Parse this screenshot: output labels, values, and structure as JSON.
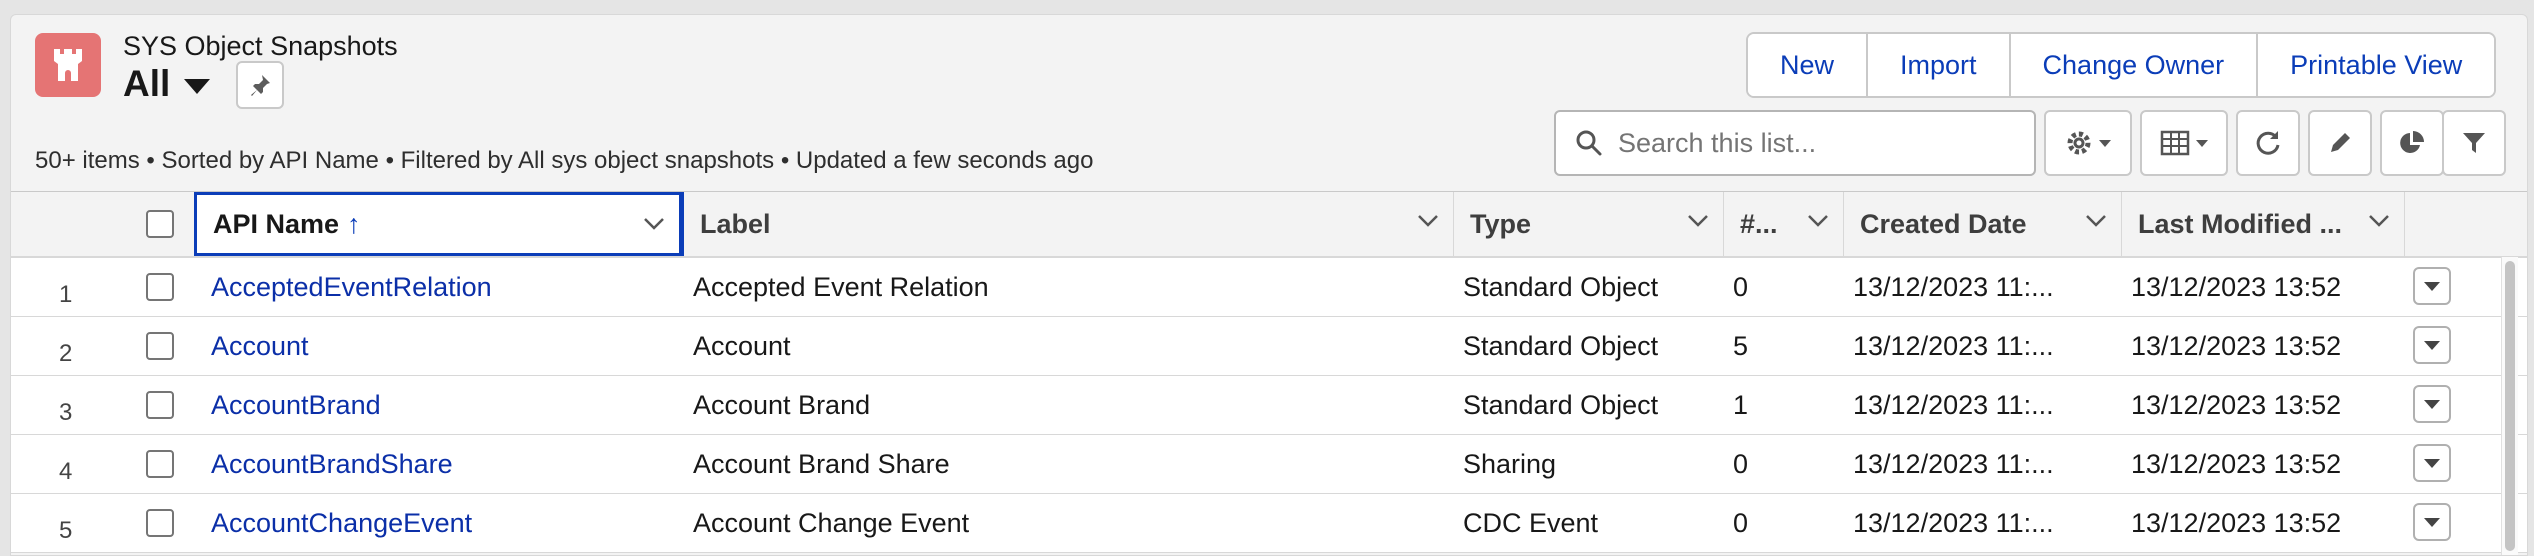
{
  "header": {
    "object_name": "SYS Object Snapshots",
    "list_view": "All",
    "meta": "50+ items • Sorted by API Name • Filtered by All sys object snapshots • Updated a few seconds ago"
  },
  "actions": {
    "new": "New",
    "import": "Import",
    "change_owner": "Change Owner",
    "printable_view": "Printable View"
  },
  "search": {
    "placeholder": "Search this list..."
  },
  "columns": {
    "api_name": "API Name",
    "sort_indicator": "↑",
    "label": "Label",
    "type": "Type",
    "count": "#...",
    "created": "Created Date",
    "modified": "Last Modified ..."
  },
  "rows": [
    {
      "num": "1",
      "api": "AcceptedEventRelation",
      "label": "Accepted Event Relation",
      "type": "Standard Object",
      "count": "0",
      "created": "13/12/2023 11:...",
      "modified": "13/12/2023 13:52"
    },
    {
      "num": "2",
      "api": "Account",
      "label": "Account",
      "type": "Standard Object",
      "count": "5",
      "created": "13/12/2023 11:...",
      "modified": "13/12/2023 13:52"
    },
    {
      "num": "3",
      "api": "AccountBrand",
      "label": "Account Brand",
      "type": "Standard Object",
      "count": "1",
      "created": "13/12/2023 11:...",
      "modified": "13/12/2023 13:52"
    },
    {
      "num": "4",
      "api": "AccountBrandShare",
      "label": "Account Brand Share",
      "type": "Sharing",
      "count": "0",
      "created": "13/12/2023 11:...",
      "modified": "13/12/2023 13:52"
    },
    {
      "num": "5",
      "api": "AccountChangeEvent",
      "label": "Account Change Event",
      "type": "CDC Event",
      "count": "0",
      "created": "13/12/2023 11:...",
      "modified": "13/12/2023 13:52"
    }
  ],
  "colors": {
    "object_icon": "#e57474",
    "link": "#0b2fa8",
    "accent": "#0b3db8"
  }
}
